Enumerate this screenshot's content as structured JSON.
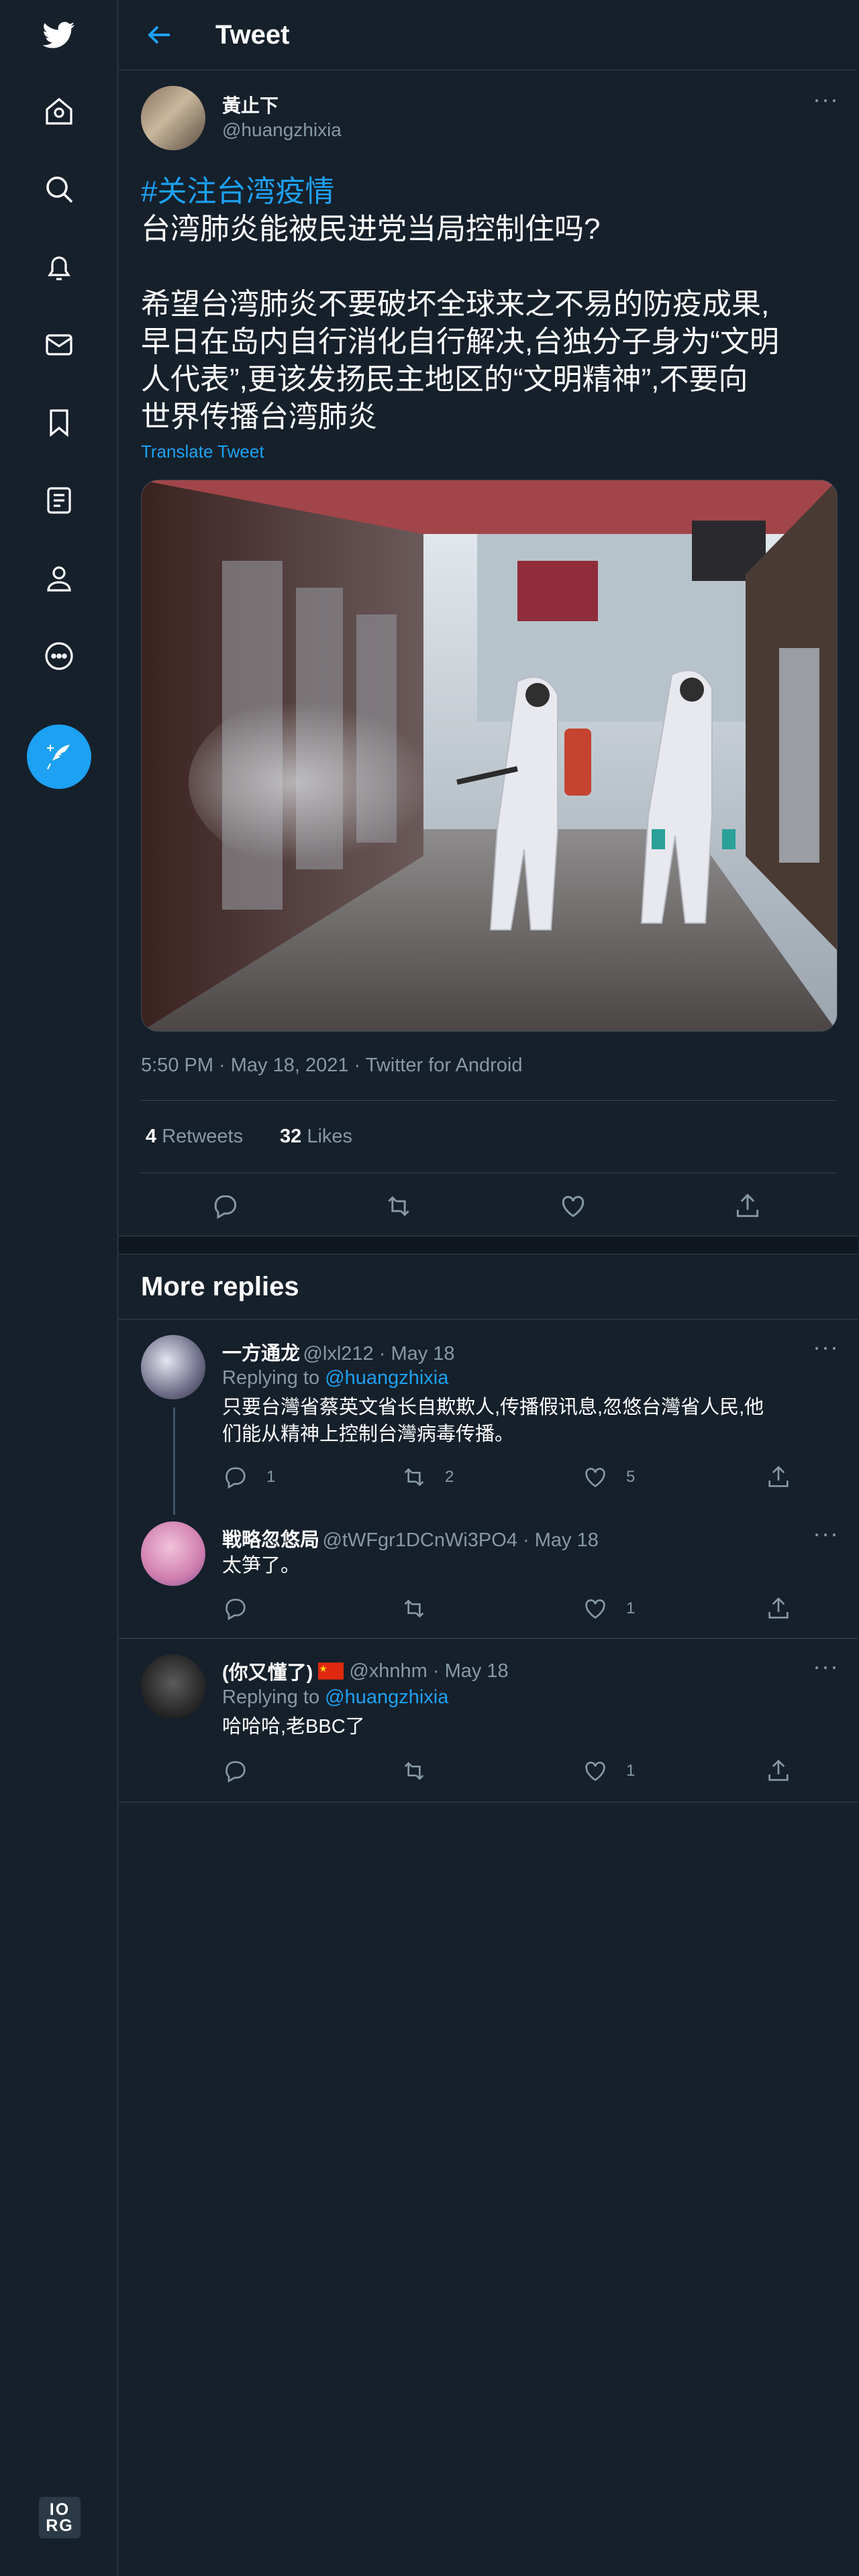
{
  "header": {
    "title": "Tweet"
  },
  "tweet": {
    "display_name": "黃止下",
    "handle": "@huangzhixia",
    "hashtag": "#关注台湾疫情",
    "text_line1": "台湾肺炎能被民进党当局控制住吗?",
    "text_paragraph": [
      "希望台湾肺炎不要破坏全球来之不易的防疫成果,",
      "早日在岛内自行消化自行解决,台独分子身为“文明",
      "人代表”,更该发扬民主地区的“文明精神”,不要向",
      "世界传播台湾肺炎"
    ],
    "translate_label": "Translate Tweet",
    "timestamp": "5:50 PM · May 18, 2021 · Twitter for Android",
    "retweets_count": "4",
    "retweets_label": "Retweets",
    "likes_count": "32",
    "likes_label": "Likes"
  },
  "more_replies": {
    "title": "More replies"
  },
  "replies": [
    {
      "name": "一方通龙",
      "meta": "@lxl212 · May 18",
      "replying_prefix": "Replying to",
      "replying_handle": "@huangzhixia",
      "text": [
        "只要台灣省蔡英文省长自欺欺人,传播假讯息,忽悠台灣省人民,他",
        "们能从精神上控制台灣病毒传播。"
      ],
      "reply_count": "1",
      "retweet_count": "2",
      "like_count": "5"
    },
    {
      "name": "戦略忽悠局",
      "meta": "@tWFgr1DCnWi3PO4 · May 18",
      "text": [
        "太笋了。"
      ],
      "reply_count": "",
      "retweet_count": "",
      "like_count": "1"
    },
    {
      "name": "(你又懂了)",
      "meta": "@xhnhm · May 18",
      "replying_prefix": "Replying to",
      "replying_handle": "@huangzhixia",
      "text": [
        "哈哈哈,老BBC了"
      ],
      "reply_count": "",
      "retweet_count": "",
      "like_count": "1"
    }
  ],
  "footer": {
    "badge_line1": "IO",
    "badge_line2": "RG"
  },
  "icons": [
    "twitter-logo-icon",
    "home-icon",
    "explore-icon",
    "notifications-icon",
    "messages-icon",
    "bookmarks-icon",
    "lists-icon",
    "profile-icon",
    "more-icon",
    "compose-icon",
    "back-arrow-icon",
    "reply-icon",
    "retweet-icon",
    "like-icon",
    "share-icon"
  ],
  "colors": {
    "background": "#15202b",
    "accent": "#1da1f2",
    "muted": "#8899a6",
    "border": "#38444d"
  }
}
